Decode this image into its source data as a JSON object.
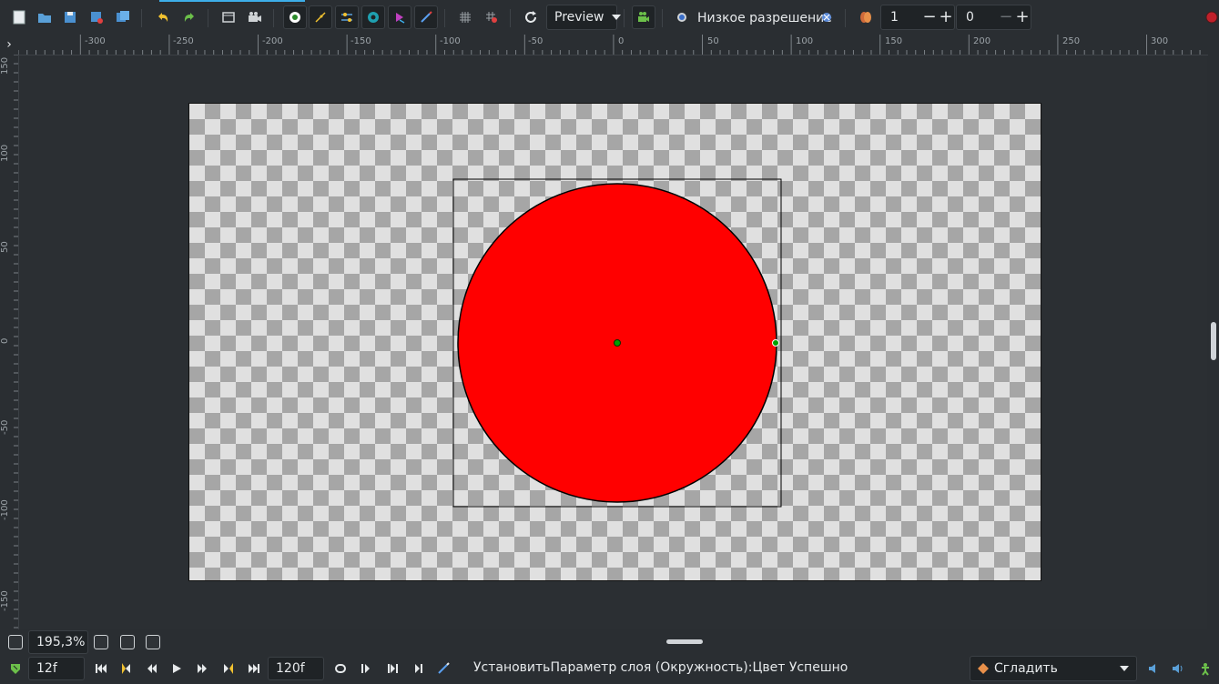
{
  "toolbar": {
    "icons": [
      "new-file-icon",
      "open-file-icon",
      "save-icon",
      "save-as-icon",
      "save-all-icon",
      "undo-icon",
      "redo-icon",
      "render-icon",
      "preview-icon",
      "onion-skin-icon",
      "bline-toggle-icon",
      "guides-icon",
      "ducks-icon",
      "keyframe-lock-icon",
      "draw-tool-icon",
      "grid-icon",
      "snap-icon",
      "refresh-icon",
      "animation-mode-icon",
      "background-icon",
      "low-res-icon",
      "past-keyframes-icon"
    ],
    "render_mode": "Preview",
    "low_resolution_label": "Низкое разрешение",
    "onion_past": "1",
    "onion_future": "0",
    "minus": "−",
    "plus": "+"
  },
  "ruler": {
    "h_ticks": [
      "-300",
      "-250",
      "-200",
      "-150",
      "-100",
      "-50",
      "0",
      "50",
      "100",
      "150",
      "200",
      "250",
      "300"
    ],
    "v_ticks": [
      "150",
      "100",
      "50",
      "0",
      "-50",
      "-100",
      "-150"
    ]
  },
  "canvas": {
    "shape": "circle",
    "fill_color": "#ff0000",
    "outline_color": "#000000",
    "handle_color": "#00a000",
    "checker_light": "#e0e0e0",
    "checker_dark": "#a6a6a6"
  },
  "zoom": {
    "value": "195,3%"
  },
  "playback": {
    "current_frame": "12f",
    "end_frame": "120f",
    "status_message": "УстановитьПараметр слоя (Окружность):Цвет Успешно",
    "interpolation": "Сгладить"
  }
}
